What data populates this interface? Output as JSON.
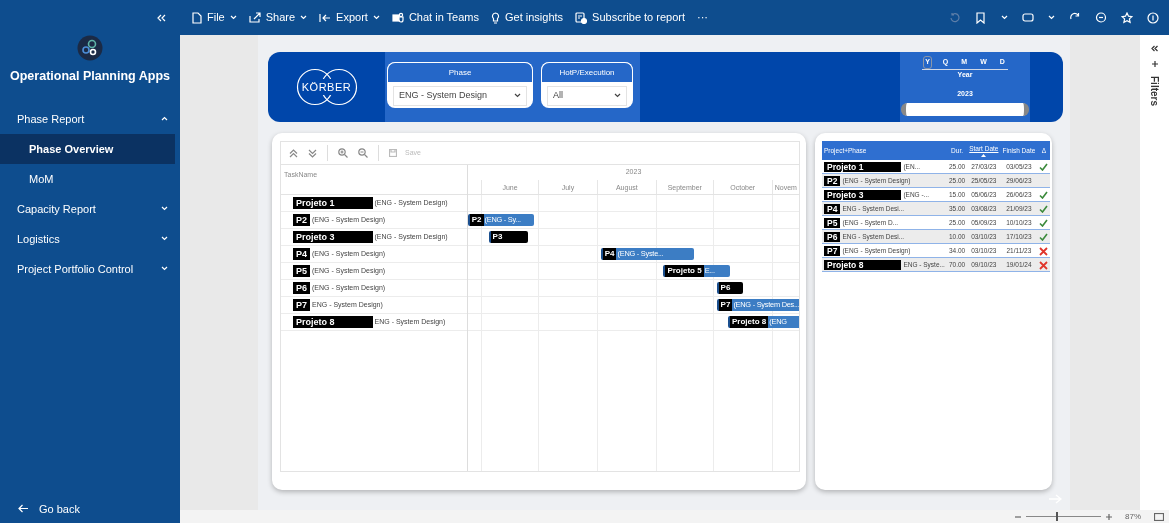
{
  "sidebar": {
    "title": "Operational Planning Apps",
    "items": [
      {
        "label": "Phase Report",
        "expanded": true,
        "children": [
          {
            "label": "Phase Overview",
            "selected": true
          },
          {
            "label": "MoM",
            "selected": false
          }
        ]
      },
      {
        "label": "Capacity Report",
        "expanded": false
      },
      {
        "label": "Logistics",
        "expanded": false
      },
      {
        "label": "Project Portfolio Control",
        "expanded": false
      }
    ],
    "back": "Go back"
  },
  "toolbar": {
    "items": [
      {
        "label": "File",
        "menu": true
      },
      {
        "label": "Share",
        "menu": true
      },
      {
        "label": "Export",
        "menu": true
      },
      {
        "label": "Chat in Teams",
        "menu": false
      },
      {
        "label": "Get insights",
        "menu": false
      },
      {
        "label": "Subscribe to report",
        "menu": false
      }
    ],
    "more": "···"
  },
  "banner": {
    "logo": "KÖRBER",
    "slicers": [
      {
        "title": "Phase",
        "value": "ENG - System Design"
      },
      {
        "title": "HotP/Execution",
        "value": "All"
      }
    ],
    "date_slicer": {
      "granularities": [
        {
          "label": "Y",
          "selected": true
        },
        {
          "label": "Q",
          "selected": false
        },
        {
          "label": "M",
          "selected": false
        },
        {
          "label": "W",
          "selected": false
        },
        {
          "label": "D",
          "selected": false
        }
      ],
      "caption": "Year",
      "value": "2023"
    }
  },
  "gantt": {
    "save": "Save",
    "task_header": "TaskName",
    "year": "2023",
    "months": [
      "June",
      "July",
      "August",
      "September",
      "October",
      "Novem"
    ],
    "tasks": [
      {
        "name": "Projeto 1",
        "phase": "(ENG - System Design)"
      },
      {
        "name": "P2",
        "phase": "(ENG - System Design)",
        "bar": {
          "name": "P2",
          "text": "(ENG - Sy..."
        }
      },
      {
        "name": "Projeto 3",
        "phase": "(ENG - System Design)",
        "bar": {
          "name": "P3"
        }
      },
      {
        "name": "P4",
        "phase": "(ENG - System Design)",
        "bar": {
          "name": "P4",
          "text": "(ENG - Syste..."
        }
      },
      {
        "name": "P5",
        "phase": "(ENG - System Design)",
        "bar": {
          "name": "Projeto 5",
          "text": "E..."
        }
      },
      {
        "name": "P6",
        "phase": "(ENG - System Design)",
        "bar": {
          "name": "P6"
        }
      },
      {
        "name": "P7",
        "phase": "ENG - System Design)",
        "bar": {
          "name": "P7",
          "text": "(ENG - System Des..."
        }
      },
      {
        "name": "Projeto 8",
        "phase": "ENG - System Design)",
        "bar": {
          "name": "Projeto 8",
          "text": "(ENG"
        }
      }
    ]
  },
  "table": {
    "columns": [
      "Project+Phase",
      "Dur.",
      "Start Date",
      "Finish Date",
      "Δ"
    ],
    "rows": [
      {
        "name": "Projeto 1",
        "phase": "(EN...",
        "dur": "25.00",
        "start": "27/03/23",
        "finish": "03/05/23",
        "kind": "ok"
      },
      {
        "name": "P2",
        "phase": "(ENG - System Design)",
        "dur": "25.00",
        "start": "25/05/23",
        "finish": "29/06/23",
        "kind": "blank"
      },
      {
        "name": "Projeto 3",
        "phase": "(ENG -...",
        "dur": "15.00",
        "start": "05/06/23",
        "finish": "26/06/23",
        "kind": "ok"
      },
      {
        "name": "P4",
        "phase": "ENG - System Desi...",
        "dur": "35.00",
        "start": "03/08/23",
        "finish": "21/09/23",
        "kind": "ok"
      },
      {
        "name": "P5",
        "phase": "(ENG - System D...",
        "dur": "25.00",
        "start": "05/09/23",
        "finish": "10/10/23",
        "kind": "ok"
      },
      {
        "name": "P6",
        "phase": "ENG - System Desi...",
        "dur": "10.00",
        "start": "03/10/23",
        "finish": "17/10/23",
        "kind": "ok"
      },
      {
        "name": "P7",
        "phase": "(ENG - System Design)",
        "dur": "34.00",
        "start": "03/10/23",
        "finish": "21/11/23",
        "kind": "late"
      },
      {
        "name": "Projeto 8",
        "phase": "ENG - Syste...",
        "dur": "70.00",
        "start": "09/10/23",
        "finish": "19/01/24",
        "kind": "late"
      }
    ]
  },
  "filters": {
    "title": "Filters"
  },
  "zoom": {
    "level": 0.4,
    "reading": "87%"
  }
}
